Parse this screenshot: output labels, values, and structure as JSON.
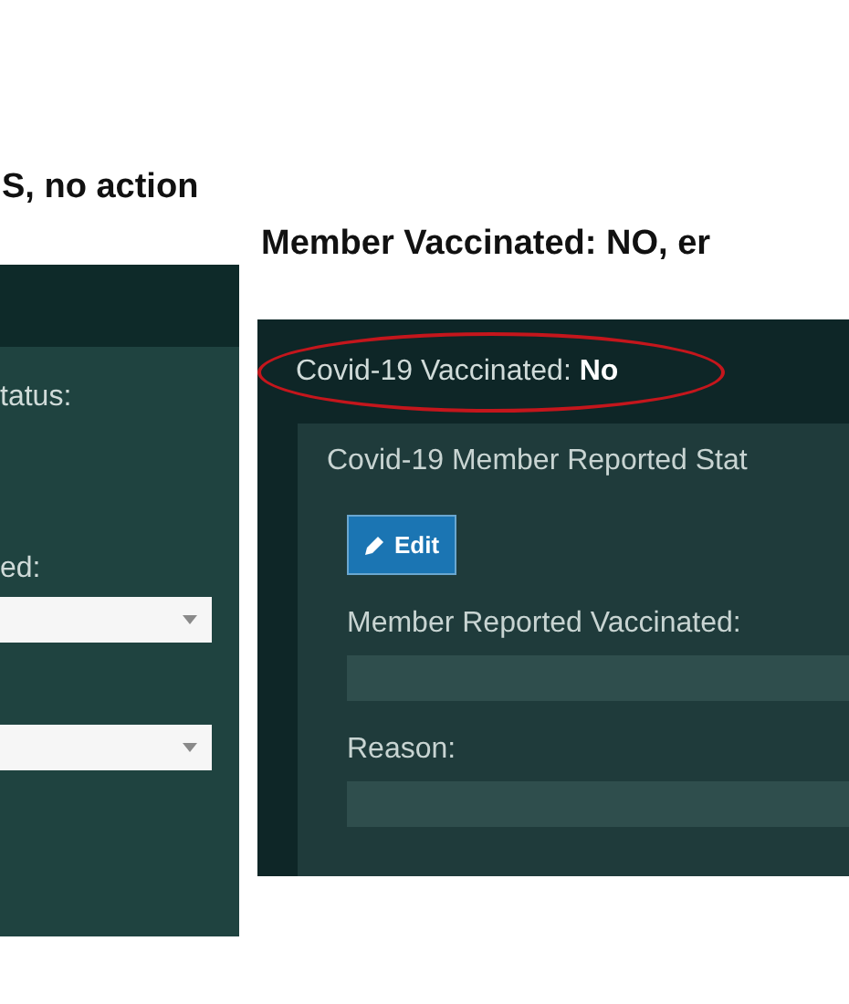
{
  "left": {
    "heading": "S, no action",
    "panel": {
      "label_1": "tatus:",
      "label_2": "ed:",
      "dropdowns": [
        {
          "kind": "select"
        },
        {
          "kind": "select"
        }
      ]
    }
  },
  "right": {
    "heading": "Member Vaccinated: NO, er",
    "panel": {
      "status": "Covid-19 Vaccinated: **No**",
      "highlighted": true,
      "section_title": "Covid-19 Member Reported Stat",
      "edit_button": "Edit",
      "fields": [
        {
          "label": "Member Reported Vaccinated:"
        },
        {
          "label": "Reason:"
        }
      ]
    }
  }
}
